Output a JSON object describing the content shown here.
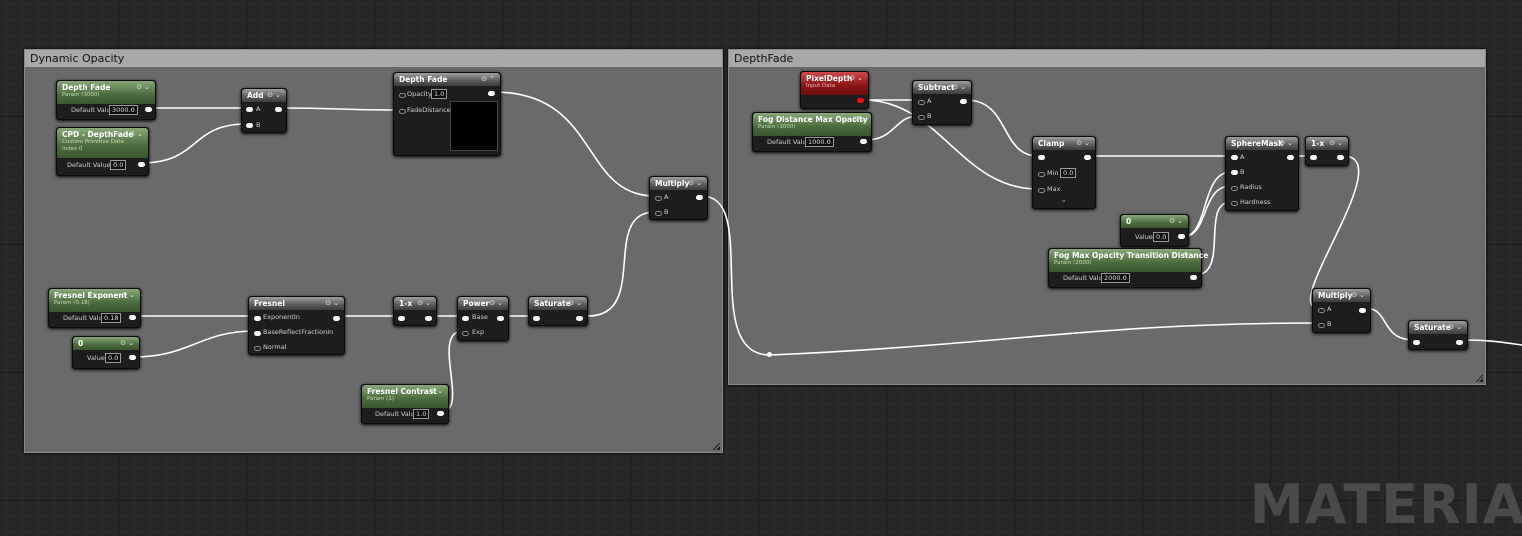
{
  "comments": {
    "dynamic_opacity": "Dynamic Opacity",
    "depth_fade": "DepthFade"
  },
  "icons": {
    "node_menu": "gear-icon",
    "collapse": "chevron-icon"
  },
  "colors": {
    "scalar_param_header": "#4b6b3c",
    "function_header": "#5a5a5a",
    "input_data_header": "#8a1414",
    "wire": "#ffffff"
  },
  "nodes": {
    "depth_fade_param": {
      "title": "Depth Fade",
      "sub": "Param (3000)",
      "pin_label": "Default Value",
      "value": "3000.0"
    },
    "cpd_depthfade": {
      "title": "CPD - DepthFade",
      "sub1": "Custom Primitive Data",
      "sub2": "Index 0",
      "pin_label": "Default Value",
      "value": "0.0"
    },
    "add": {
      "title": "Add",
      "in_a": "A",
      "in_b": "B"
    },
    "depth_fade_fn": {
      "title": "Depth Fade",
      "in_opacity": "Opacity",
      "opacity_value": "1.0",
      "in_fadedistance": "FadeDistance"
    },
    "multiply_left": {
      "title": "Multiply",
      "in_a": "A",
      "in_b": "B"
    },
    "fresnel_exponent": {
      "title": "Fresnel Exponent",
      "sub": "Param (0.18)",
      "pin_label": "Default Value",
      "value": "0.18"
    },
    "const_zero_left": {
      "title": "0",
      "pin_label": "Value",
      "value": "0.0"
    },
    "fresnel": {
      "title": "Fresnel",
      "in_exponent": "ExponentIn",
      "in_base": "BaseReflectFractionIn",
      "in_normal": "Normal"
    },
    "one_minus_left": {
      "title": "1-x"
    },
    "power": {
      "title": "Power",
      "in_base": "Base",
      "in_exp": "Exp"
    },
    "saturate_left": {
      "title": "Saturate"
    },
    "fresnel_contrast": {
      "title": "Fresnel Contrast",
      "sub": "Param (1)",
      "pin_label": "Default Value",
      "value": "1.0"
    },
    "pixel_depth": {
      "title": "PixelDepth",
      "sub": "Input Data"
    },
    "fog_max_opacity": {
      "title": "Fog Distance Max Opacity",
      "sub": "Param (1000)",
      "pin_label": "Default Value",
      "value": "1000.0"
    },
    "subtract": {
      "title": "Subtract",
      "in_a": "A",
      "in_b": "B"
    },
    "clamp": {
      "title": "Clamp",
      "in_min": "Min",
      "min_value": "0.0",
      "in_max": "Max"
    },
    "spheremask": {
      "title": "SphereMask",
      "in_a": "A",
      "in_b": "B",
      "in_radius": "Radius",
      "in_hardness": "Hardness"
    },
    "one_minus_right": {
      "title": "1-x"
    },
    "const_zero_right": {
      "title": "0",
      "pin_label": "Value",
      "value": "0.0"
    },
    "fog_transition": {
      "title": "Fog Max Opacity Transition Distance",
      "sub": "Param (2000)",
      "pin_label": "Default Value",
      "value": "2000.0"
    },
    "multiply_right": {
      "title": "Multiply",
      "in_a": "A",
      "in_b": "B"
    },
    "saturate_right": {
      "title": "Saturate"
    }
  },
  "watermark": "MATERIAL"
}
